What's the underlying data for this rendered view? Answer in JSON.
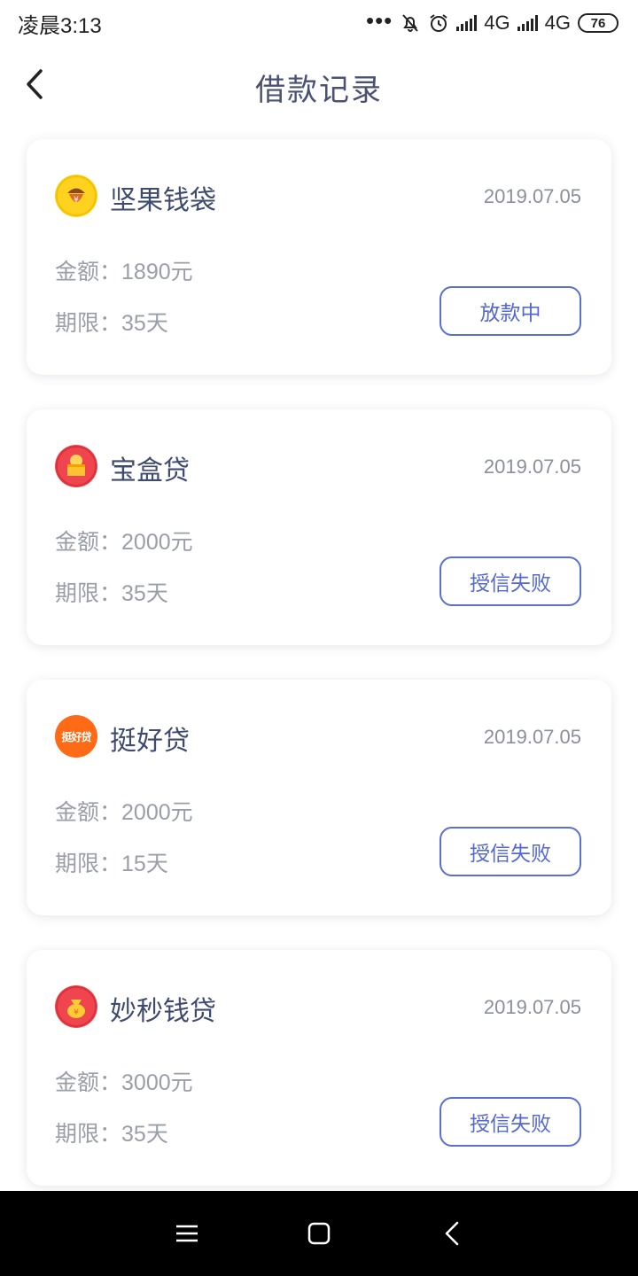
{
  "status_bar": {
    "time": "凌晨3:13",
    "signal1": "4G",
    "signal2": "4G",
    "battery": "76"
  },
  "nav": {
    "title": "借款记录"
  },
  "labels": {
    "amount": "金额：",
    "term": "期限："
  },
  "records": [
    {
      "name": "坚果钱袋",
      "date": "2019.07.05",
      "amount": "1890元",
      "term": "35天",
      "status": "放款中",
      "logo_color": "#ffd21f",
      "logo_icon": "acorn-icon"
    },
    {
      "name": "宝盒贷",
      "date": "2019.07.05",
      "amount": "2000元",
      "term": "35天",
      "status": "授信失败",
      "logo_color": "#f0454e",
      "logo_icon": "treasure-box-icon"
    },
    {
      "name": "挺好贷",
      "date": "2019.07.05",
      "amount": "2000元",
      "term": "15天",
      "status": "授信失败",
      "logo_color": "#ff6a16",
      "logo_icon": "tinghaodai-logo",
      "logo_text": "挺好贷"
    },
    {
      "name": "妙秒钱贷",
      "date": "2019.07.05",
      "amount": "3000元",
      "term": "35天",
      "status": "授信失败",
      "logo_color": "#f0454e",
      "logo_icon": "money-bag-icon"
    }
  ],
  "colors": {
    "accent": "#5468cf",
    "title": "#4a5273"
  }
}
